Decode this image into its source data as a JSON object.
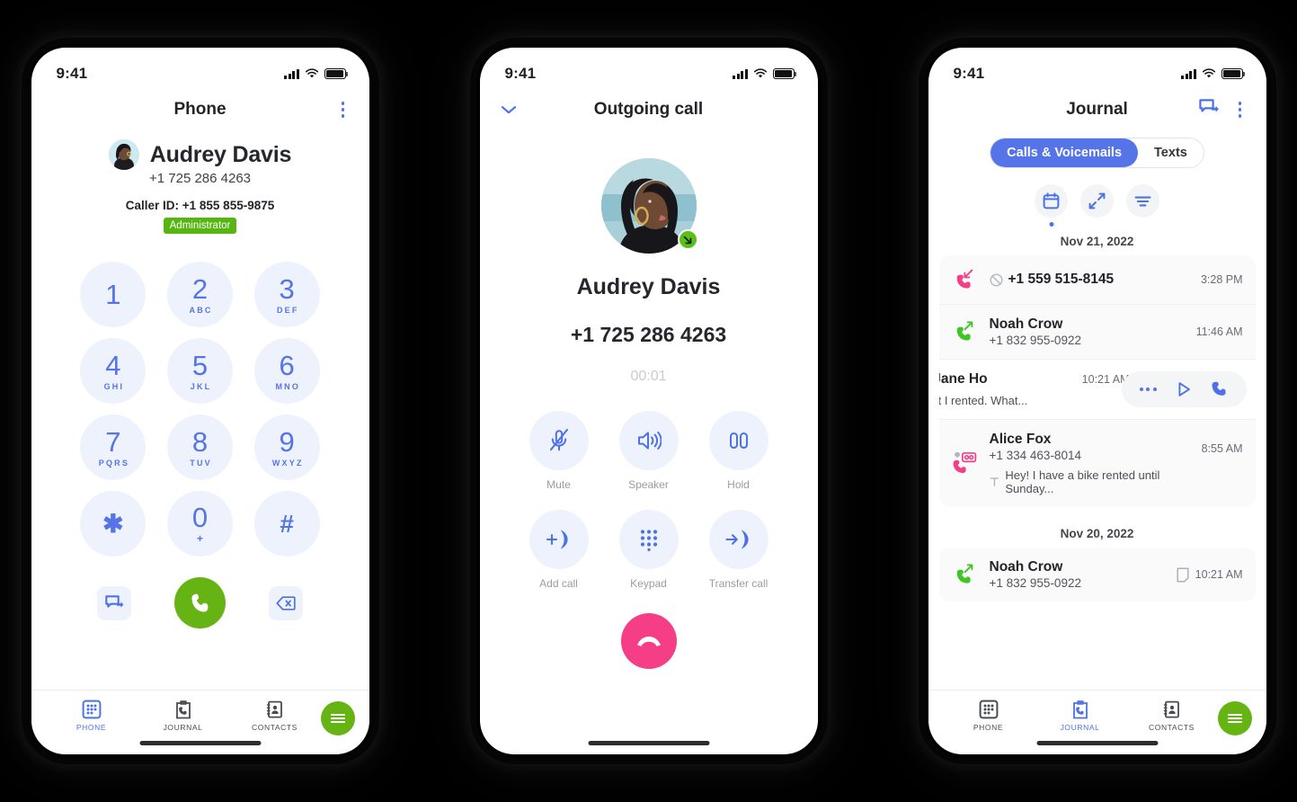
{
  "statusbar": {
    "time": "9:41",
    "signal_icon": "cellular-signal-icon",
    "wifi_icon": "wifi-icon",
    "battery_icon": "battery-icon"
  },
  "colors": {
    "accent_blue": "#5574e8",
    "key_bg": "#eef2fd",
    "green": "#66b413",
    "pink": "#f53e85",
    "badge_green": "#56b510",
    "muted": "#9a9ca5"
  },
  "phone1": {
    "title": "Phone",
    "menu_icon": "kebab-menu-icon",
    "contact": {
      "name": "Audrey Davis",
      "number": "+1 725 286 4263",
      "caller_id": "Caller ID: +1 855 855-9875",
      "badge": "Administrator",
      "avatar_icon": "contact-avatar"
    },
    "dialpad": [
      {
        "digit": "1",
        "letters": ""
      },
      {
        "digit": "2",
        "letters": "ABC"
      },
      {
        "digit": "3",
        "letters": "DEF"
      },
      {
        "digit": "4",
        "letters": "GHI"
      },
      {
        "digit": "5",
        "letters": "JKL"
      },
      {
        "digit": "6",
        "letters": "MNO"
      },
      {
        "digit": "7",
        "letters": "PQRS"
      },
      {
        "digit": "8",
        "letters": "TUV"
      },
      {
        "digit": "9",
        "letters": "WXYZ"
      },
      {
        "digit": "✱",
        "letters": ""
      },
      {
        "digit": "0",
        "letters": "+"
      },
      {
        "digit": "#",
        "letters": ""
      }
    ],
    "actions": {
      "message_icon": "message-forward-icon",
      "call_icon": "call-icon",
      "backspace_icon": "backspace-icon"
    },
    "tabs": [
      {
        "label": "PHONE",
        "icon": "dialpad-icon",
        "active": true
      },
      {
        "label": "JOURNAL",
        "icon": "journal-clipboard-icon",
        "active": false
      },
      {
        "label": "CONTACTS",
        "icon": "contacts-book-icon",
        "active": false
      }
    ],
    "fab_icon": "menu-fab-icon"
  },
  "phone2": {
    "title": "Outgoing call",
    "collapse_icon": "chevron-down-icon",
    "avatar_icon": "caller-photo",
    "direction_icon": "outgoing-arrow-icon",
    "name": "Audrey Davis",
    "number": "+1 725 286 4263",
    "timer": "00:01",
    "controls": [
      {
        "label": "Mute",
        "icon": "mic-muted-icon"
      },
      {
        "label": "Speaker",
        "icon": "speaker-icon"
      },
      {
        "label": "Hold",
        "icon": "hold-pause-icon"
      },
      {
        "label": "Add call",
        "icon": "add-call-icon"
      },
      {
        "label": "Keypad",
        "icon": "keypad-icon"
      },
      {
        "label": "Transfer call",
        "icon": "transfer-call-icon"
      }
    ],
    "hangup_icon": "end-call-icon"
  },
  "phone3": {
    "title": "Journal",
    "message_icon": "message-forward-icon",
    "menu_icon": "kebab-menu-icon",
    "segments": [
      {
        "label": "Calls & Voicemails",
        "active": true
      },
      {
        "label": "Texts",
        "active": false
      }
    ],
    "filters": [
      {
        "icon": "calendar-icon",
        "active": true
      },
      {
        "icon": "direction-arrows-icon",
        "active": false
      },
      {
        "icon": "filter-lines-icon",
        "active": false
      }
    ],
    "groups": [
      {
        "date": "Nov 21, 2022",
        "rows": [
          {
            "type": "missed",
            "direction_icon": "incoming-missed-call-icon",
            "blocked_icon": "blocked-icon",
            "name": "+1 559 515-8145",
            "number": "",
            "time": "3:28 PM",
            "preview": "",
            "preview_icon": ""
          },
          {
            "type": "outgoing",
            "direction_icon": "outgoing-call-icon",
            "name": "Noah Crow",
            "number": "+1 832 955-0922",
            "time": "11:46 AM",
            "preview": "",
            "preview_icon": ""
          },
          {
            "type": "swiped",
            "direction_icon": "voicemail-icon",
            "name": "y-Jane Ho",
            "number": "",
            "time": "10:21 AM",
            "preview": "the helmet I rented. What...",
            "preview_icon": "",
            "actions": [
              {
                "icon": "more-dots-icon"
              },
              {
                "icon": "play-icon"
              },
              {
                "icon": "call-icon"
              }
            ]
          },
          {
            "type": "voicemail",
            "direction_icon": "voicemail-missed-icon",
            "unread_icon": "unread-dot-icon",
            "name": "Alice Fox",
            "number": "+1 334 463-8014",
            "time": "8:55 AM",
            "preview": "Hey! I have a bike rented until Sunday...",
            "preview_icon": "transcript-icon"
          }
        ]
      },
      {
        "date": "Nov 20, 2022",
        "rows": [
          {
            "type": "outgoing",
            "direction_icon": "outgoing-call-icon",
            "name": "Noah Crow",
            "number": "+1 832 955-0922",
            "time": "10:21 AM",
            "note_icon": "note-icon",
            "preview": "",
            "preview_icon": ""
          }
        ]
      }
    ],
    "tabs": [
      {
        "label": "PHONE",
        "icon": "dialpad-icon",
        "active": false
      },
      {
        "label": "JOURNAL",
        "icon": "journal-clipboard-icon",
        "active": true
      },
      {
        "label": "CONTACTS",
        "icon": "contacts-book-icon",
        "active": false
      }
    ],
    "fab_icon": "menu-fab-icon"
  }
}
